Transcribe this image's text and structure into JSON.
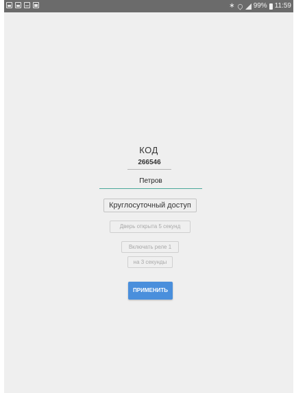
{
  "status_bar": {
    "notification_icons": [
      "image-icon",
      "gallery-icon",
      "mail-icon",
      "bag-icon"
    ],
    "bluetooth_icon": "bluetooth-icon",
    "wifi_icon": "wifi-icon",
    "signal_icon": "signal-icon",
    "battery_level": "99%",
    "time": "11:59"
  },
  "form": {
    "title": "КОД",
    "code_value": "266546",
    "name_value": "Петров",
    "access_button_label": "Круглосуточный доступ",
    "door_button_label": "Дверь открыта 5 секунд",
    "relay_button_label": "Включать реле 1",
    "duration_button_label": "на 3 секунды",
    "apply_button_label": "ПРИМЕНИТЬ"
  },
  "colors": {
    "accent_blue": "#4a8fdc",
    "input_underline_active": "#4aa79a",
    "background": "#efefef",
    "status_bar": "#6b6b6b"
  }
}
